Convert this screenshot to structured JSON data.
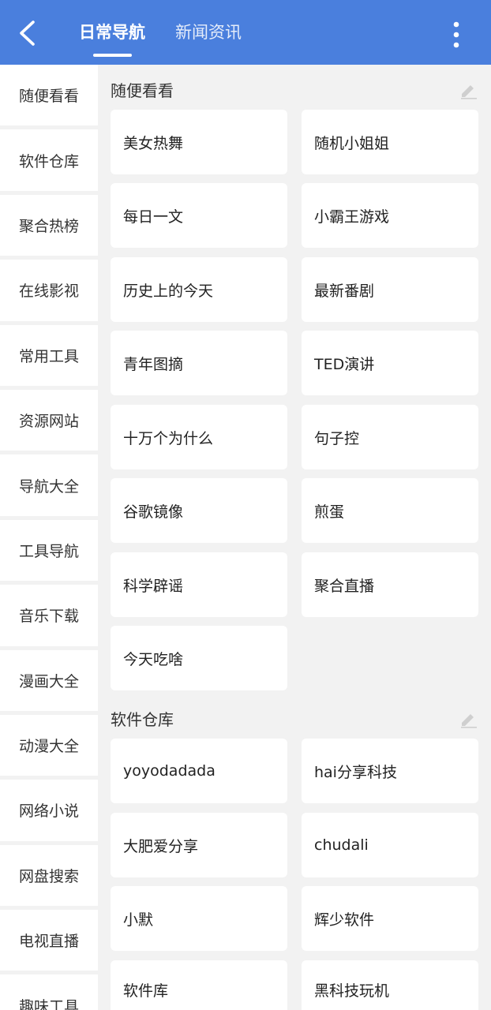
{
  "appbar": {
    "tabs": [
      {
        "label": "日常导航",
        "active": true
      },
      {
        "label": "新闻资讯",
        "active": false
      }
    ],
    "color": "#4a7fdd",
    "icons": {
      "back": "back-arrow-icon",
      "more": "more-vertical-icon"
    }
  },
  "sidebar": {
    "items": [
      "随便看看",
      "软件仓库",
      "聚合热榜",
      "在线影视",
      "常用工具",
      "资源网站",
      "导航大全",
      "工具导航",
      "音乐下载",
      "漫画大全",
      "动漫大全",
      "网络小说",
      "网盘搜索",
      "电视直播",
      "趣味工具"
    ]
  },
  "sections": [
    {
      "title": "随便看看",
      "items": [
        "美女热舞",
        "随机小姐姐",
        "每日一文",
        "小霸王游戏",
        "历史上的今天",
        "最新番剧",
        "青年图摘",
        "TED演讲",
        "十万个为什么",
        "句子控",
        "谷歌镜像",
        "煎蛋",
        "科学辟谣",
        "聚合直播",
        "今天吃啥"
      ]
    },
    {
      "title": "软件仓库",
      "items": [
        "yoyodadada",
        "hai分享科技",
        "大肥爱分享",
        "chudali",
        "小默",
        "辉少软件",
        "软件库",
        "黑科技玩机"
      ]
    }
  ]
}
